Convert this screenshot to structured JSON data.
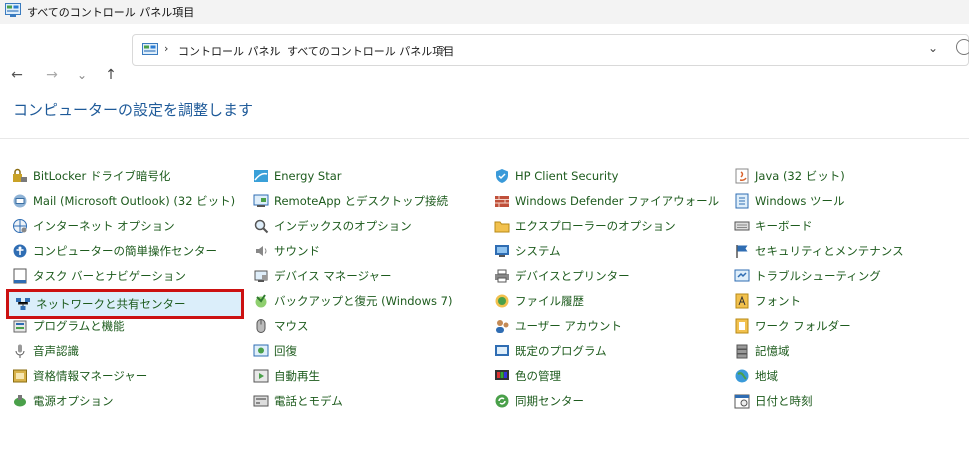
{
  "window": {
    "title": "すべてのコントロール パネル項目"
  },
  "nav": {
    "back": "←",
    "forward": "→",
    "recent": "⌄",
    "up": "↑"
  },
  "address": {
    "crumbs": [
      "コントロール パネル",
      "すべてのコントロール パネル項目"
    ],
    "separator": "›",
    "dropdown": "⌄"
  },
  "page": {
    "heading": "コンピューターの設定を調整します"
  },
  "columns": [
    [
      {
        "label": "BitLocker ドライブ暗号化",
        "icon": "bitlocker-icon"
      },
      {
        "label": "Mail (Microsoft Outlook) (32 ビット)",
        "icon": "mail-icon"
      },
      {
        "label": "インターネット オプション",
        "icon": "internet-options-icon"
      },
      {
        "label": "コンピューターの簡単操作センター",
        "icon": "ease-of-access-icon"
      },
      {
        "label": "タスク バーとナビゲーション",
        "icon": "taskbar-icon"
      },
      {
        "label": "ネットワークと共有センター",
        "icon": "network-icon",
        "selected": true
      },
      {
        "label": "プログラムと機能",
        "icon": "programs-icon"
      },
      {
        "label": "音声認識",
        "icon": "microphone-icon"
      },
      {
        "label": "資格情報マネージャー",
        "icon": "credential-icon"
      },
      {
        "label": "電源オプション",
        "icon": "power-icon"
      }
    ],
    [
      {
        "label": "Energy Star",
        "icon": "energy-star-icon"
      },
      {
        "label": "RemoteApp とデスクトップ接続",
        "icon": "remoteapp-icon"
      },
      {
        "label": "インデックスのオプション",
        "icon": "indexing-icon"
      },
      {
        "label": "サウンド",
        "icon": "speaker-icon"
      },
      {
        "label": "デバイス マネージャー",
        "icon": "device-manager-icon"
      },
      {
        "label": "バックアップと復元 (Windows 7)",
        "icon": "backup-icon"
      },
      {
        "label": "マウス",
        "icon": "mouse-icon"
      },
      {
        "label": "回復",
        "icon": "recovery-icon"
      },
      {
        "label": "自動再生",
        "icon": "autoplay-icon"
      },
      {
        "label": "電話とモデム",
        "icon": "phone-modem-icon"
      }
    ],
    [
      {
        "label": "HP Client Security",
        "icon": "hp-security-icon"
      },
      {
        "label": "Windows Defender ファイアウォール",
        "icon": "firewall-icon"
      },
      {
        "label": "エクスプローラーのオプション",
        "icon": "folder-options-icon"
      },
      {
        "label": "システム",
        "icon": "system-icon"
      },
      {
        "label": "デバイスとプリンター",
        "icon": "printer-icon"
      },
      {
        "label": "ファイル履歴",
        "icon": "file-history-icon"
      },
      {
        "label": "ユーザー アカウント",
        "icon": "user-accounts-icon"
      },
      {
        "label": "既定のプログラム",
        "icon": "default-programs-icon"
      },
      {
        "label": "色の管理",
        "icon": "color-management-icon"
      },
      {
        "label": "同期センター",
        "icon": "sync-center-icon"
      }
    ],
    [
      {
        "label": "Java (32 ビット)",
        "icon": "java-icon"
      },
      {
        "label": "Windows ツール",
        "icon": "windows-tools-icon"
      },
      {
        "label": "キーボード",
        "icon": "keyboard-icon"
      },
      {
        "label": "セキュリティとメンテナンス",
        "icon": "flag-icon"
      },
      {
        "label": "トラブルシューティング",
        "icon": "troubleshooting-icon"
      },
      {
        "label": "フォント",
        "icon": "fonts-icon"
      },
      {
        "label": "ワーク フォルダー",
        "icon": "work-folders-icon"
      },
      {
        "label": "記憶域",
        "icon": "storage-icon"
      },
      {
        "label": "地域",
        "icon": "region-icon"
      },
      {
        "label": "日付と時刻",
        "icon": "datetime-icon"
      }
    ]
  ]
}
